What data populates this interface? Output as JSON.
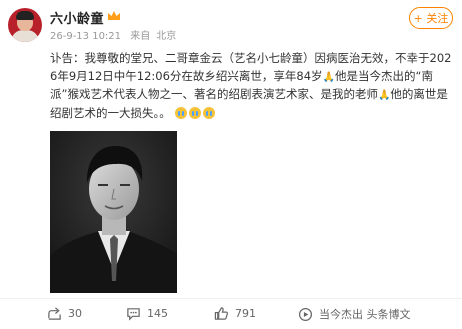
{
  "post": {
    "username": "六小龄童",
    "time": "26-9-13 10:21",
    "location_prefix": "来自",
    "location": "北京",
    "follow_label": "+ 关注",
    "text_intro": "讣告：我尊敬的堂兄、二哥章金云（艺名小七龄童）因病医治无效，不幸于2026年9月12日中午12:06分在故乡绍兴离世，享年84岁",
    "text_mid": "他是当今杰出的“南派”猴戏艺术代表人物之一、著名的绍剧表演艺术家、是我的老师",
    "text_end": "他的离世是绍剧艺术的一大损失。。",
    "pray_emoji": "🙏"
  },
  "icons": {
    "badge": "crown-icon",
    "share": "share-icon",
    "comment": "comment-icon",
    "like": "like-icon",
    "recommend": "recommend-icon",
    "emoji": "crying-emoji-icon"
  },
  "actions": {
    "share_count": "30",
    "comment_count": "145",
    "like_count": "791",
    "recommend_label": "当今杰出 头条博文"
  },
  "colors": {
    "accent": "#ff8200",
    "text": "#333333",
    "meta": "#999999"
  }
}
